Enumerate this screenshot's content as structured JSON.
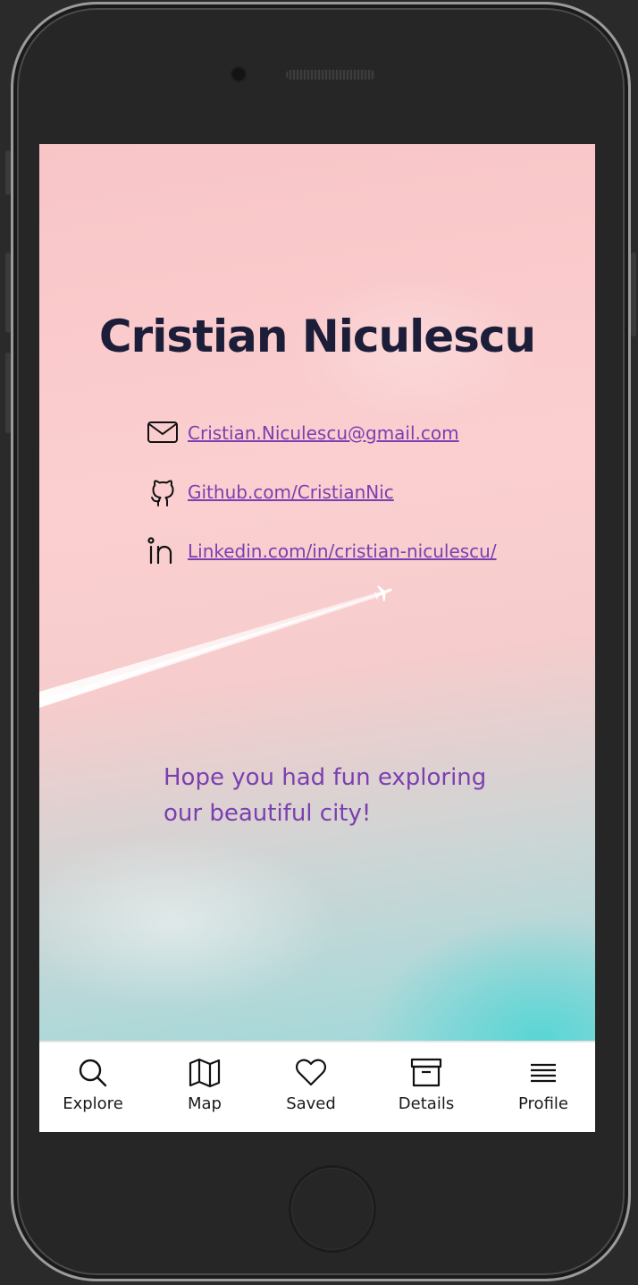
{
  "profile": {
    "name": "Cristian Niculescu",
    "contacts": [
      {
        "icon": "mail-icon",
        "text": "Cristian.Niculescu@gmail.com"
      },
      {
        "icon": "github-icon",
        "text": "Github.com/CristianNic"
      },
      {
        "icon": "linkedin-icon",
        "text": "Linkedin.com/in/cristian-niculescu/"
      }
    ],
    "message_line1": "Hope you had fun exploring",
    "message_line2": "our beautiful city!"
  },
  "tabbar": {
    "tabs": [
      {
        "label": "Explore",
        "icon": "search-icon"
      },
      {
        "label": "Map",
        "icon": "map-icon"
      },
      {
        "label": "Saved",
        "icon": "heart-icon"
      },
      {
        "label": "Details",
        "icon": "archive-icon"
      },
      {
        "label": "Profile",
        "icon": "menu-icon"
      }
    ]
  },
  "colors": {
    "title": "#1c1d38",
    "link": "#7b3fb0",
    "message": "#7b3fb0",
    "background_top": "#f8c5c7",
    "background_bottom": "#5ad5d5"
  }
}
